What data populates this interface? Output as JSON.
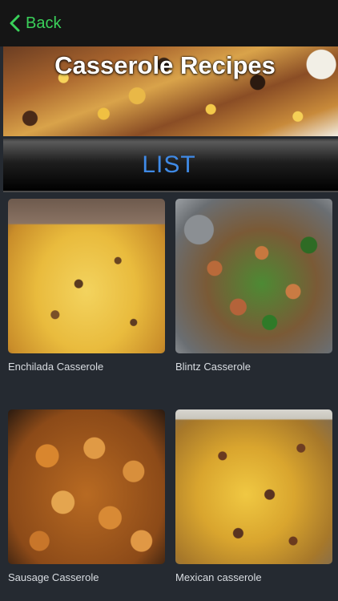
{
  "nav": {
    "back_label": "Back",
    "accent": "#3ad15a"
  },
  "banner": {
    "title": "Casserole Recipes"
  },
  "section": {
    "label": "LIST",
    "accent": "#3f8ae6"
  },
  "recipes": [
    {
      "title": "Enchilada Casserole",
      "image": "enchilada-casserole-photo"
    },
    {
      "title": "Blintz Casserole",
      "image": "blintz-casserole-photo"
    },
    {
      "title": "Sausage Casserole",
      "image": "sausage-casserole-photo"
    },
    {
      "title": "Mexican casserole",
      "image": "mexican-casserole-photo"
    }
  ]
}
